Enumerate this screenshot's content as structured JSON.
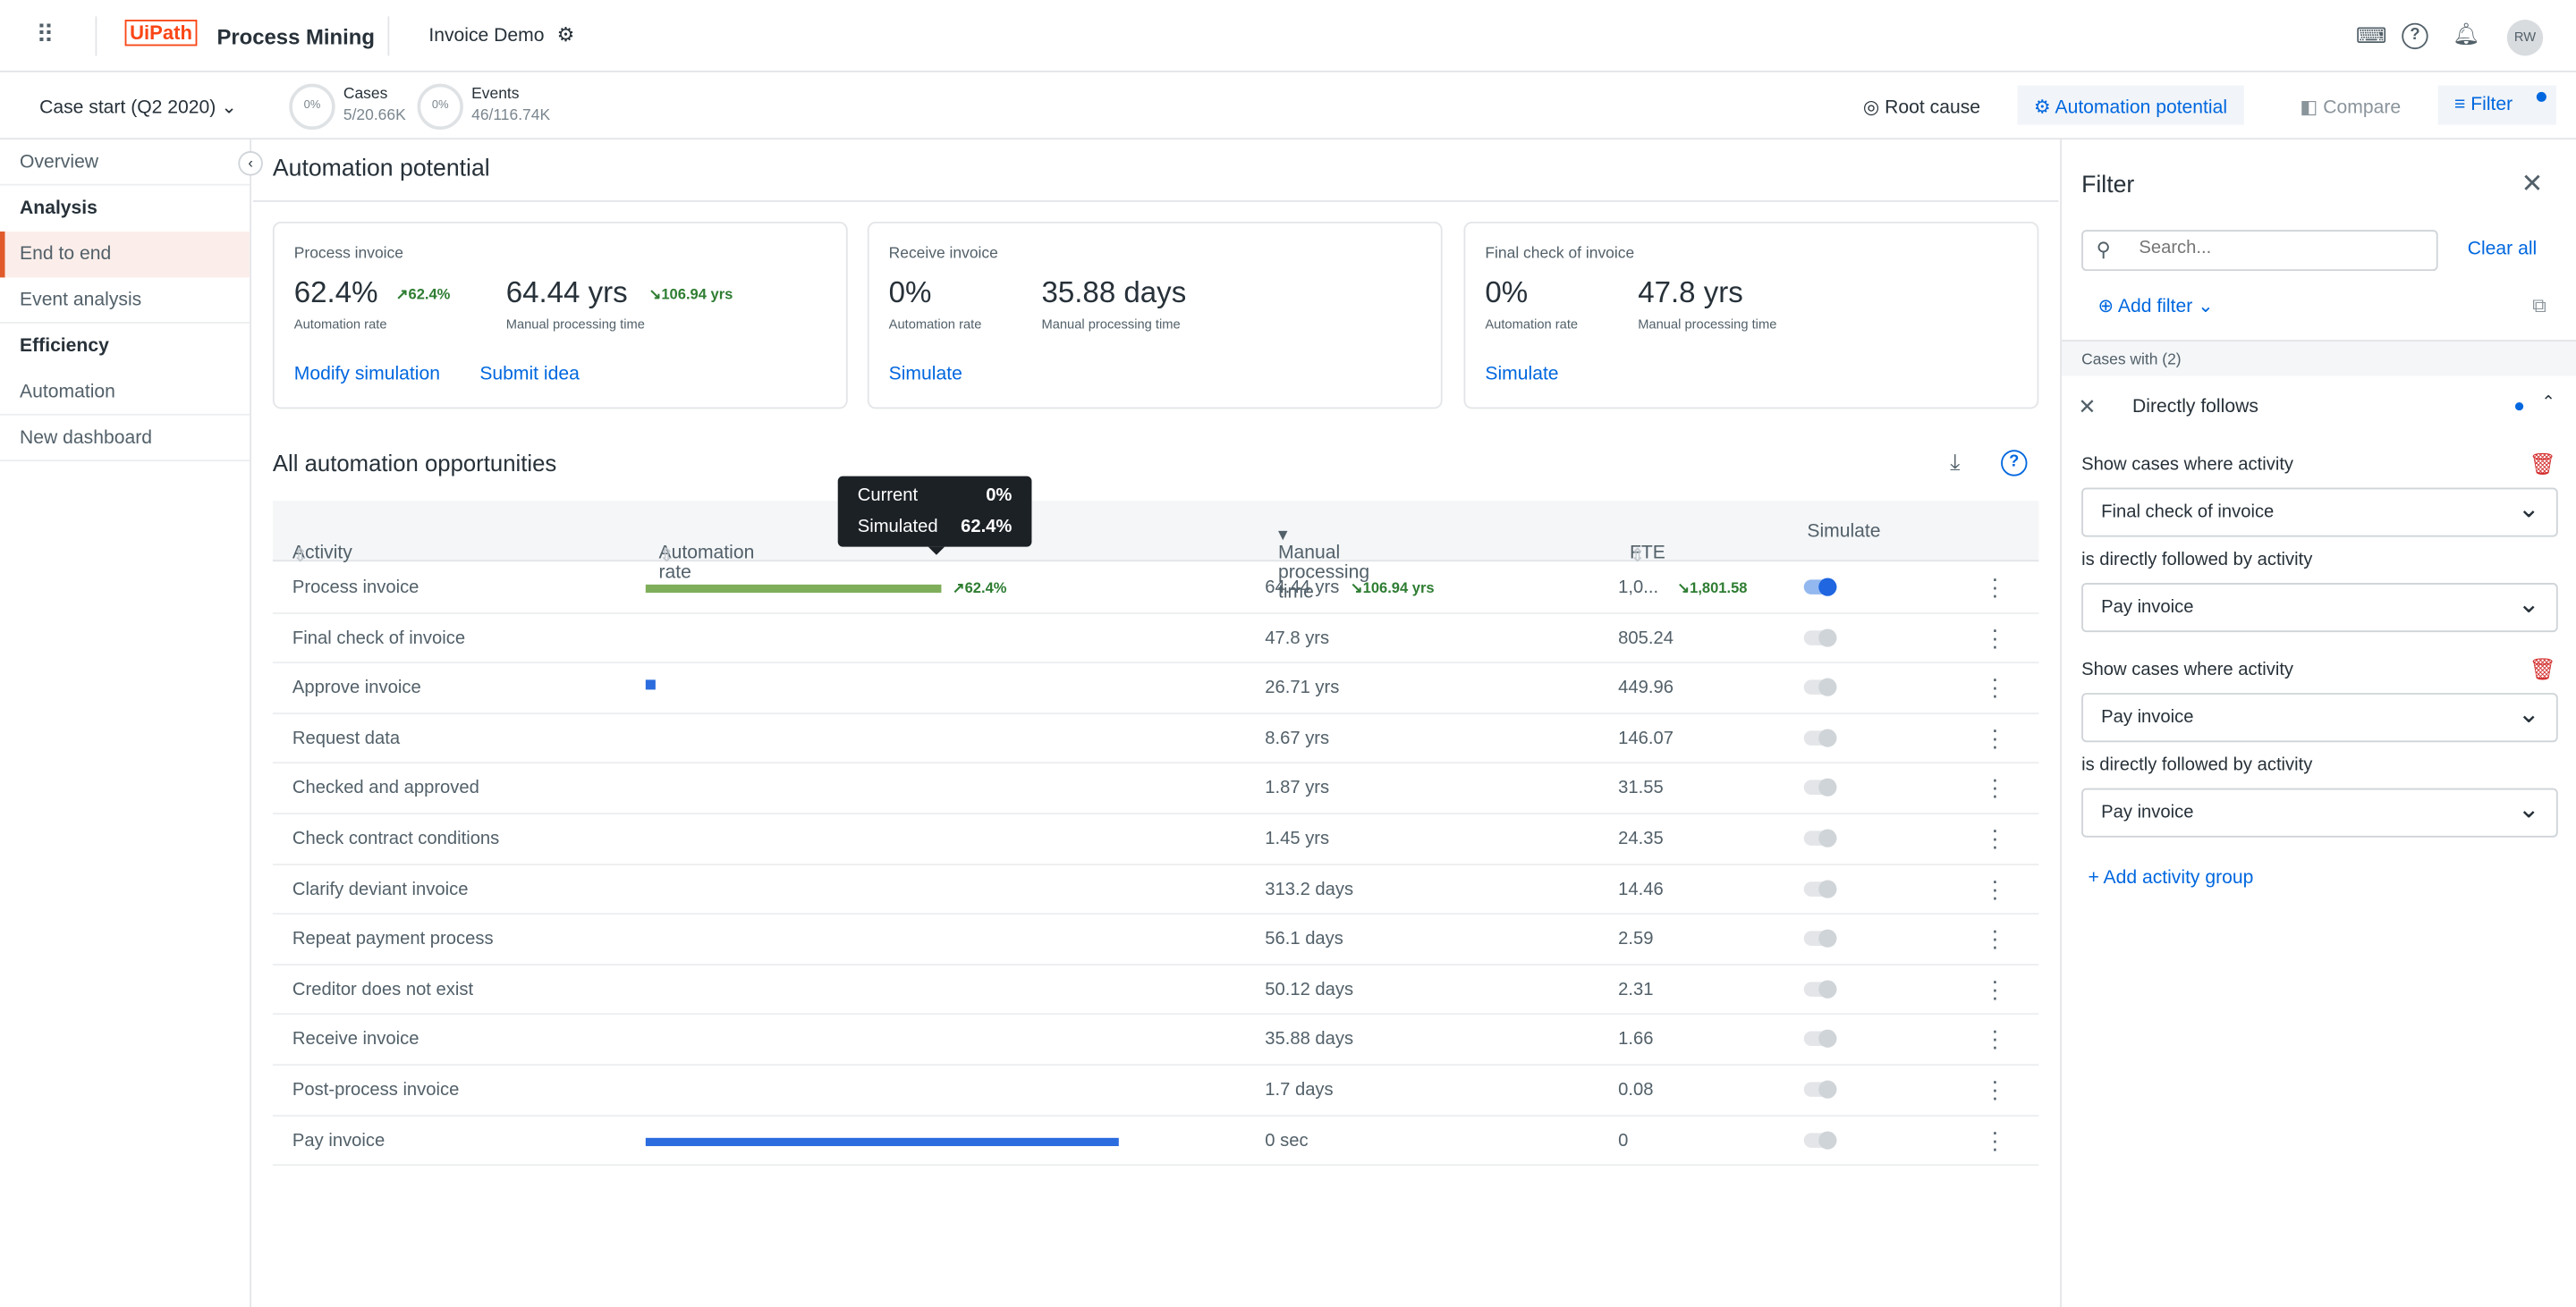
{
  "header": {
    "brand_logo": "UiPath",
    "brand": "Process Mining",
    "app": "Invoice Demo",
    "avatar": "RW",
    "icons": [
      "apps-grid-icon",
      "gear-icon",
      "keyboard-icon",
      "help-icon",
      "bell-icon"
    ]
  },
  "subbar": {
    "date_filter": "Case start (Q2 2020)",
    "cases": {
      "pct": "0%",
      "label": "Cases",
      "value": "5/20.66K"
    },
    "events": {
      "pct": "0%",
      "label": "Events",
      "value": "46/116.74K"
    },
    "buttons": [
      {
        "label": "Root cause"
      },
      {
        "label": "Automation potential"
      },
      {
        "label": "Compare"
      },
      {
        "label": "Filter"
      }
    ]
  },
  "sidebar": {
    "items": [
      {
        "label": "Overview"
      },
      {
        "label": "Analysis"
      },
      {
        "label": "End to end"
      },
      {
        "label": "Event analysis"
      },
      {
        "label": "Efficiency"
      },
      {
        "label": "Automation"
      },
      {
        "label": "New dashboard"
      }
    ]
  },
  "main": {
    "title": "Automation potential",
    "cards": [
      {
        "title": "Process invoice",
        "rate": "62.4%",
        "rate_delta": "62.4%",
        "rate_label": "Automation rate",
        "time": "64.44 yrs",
        "time_delta": "106.94 yrs",
        "time_label": "Manual processing time",
        "links": [
          "Modify simulation",
          "Submit idea"
        ]
      },
      {
        "title": "Receive invoice",
        "rate": "0%",
        "rate_label": "Automation rate",
        "time": "35.88 days",
        "time_label": "Manual processing time",
        "links": [
          "Simulate"
        ]
      },
      {
        "title": "Final check of invoice",
        "rate": "0%",
        "rate_label": "Automation rate",
        "time": "47.8 yrs",
        "time_label": "Manual processing time",
        "links": [
          "Simulate"
        ]
      }
    ],
    "table_title": "All automation opportunities",
    "columns": [
      "Activity",
      "Automation rate",
      "Manual processing time",
      "FTE",
      "Simulate"
    ],
    "tooltip": {
      "current_label": "Current",
      "current": "0%",
      "simulated_label": "Simulated",
      "simulated": "62.4%"
    },
    "rows": [
      {
        "activity": "Process invoice",
        "rate": 62.4,
        "rate_label": "62.4%",
        "rate_color": "#7fae5a",
        "time": "64.44 yrs",
        "time_delta": "106.94 yrs",
        "fte": "1,0...",
        "fte_delta": "1,801.58",
        "simulate": true
      },
      {
        "activity": "Final check of invoice",
        "rate": 0,
        "time": "47.8 yrs",
        "fte": "805.24",
        "simulate": false
      },
      {
        "activity": "Approve invoice",
        "rate": 2,
        "rate_color": "#2b6cde",
        "time": "26.71 yrs",
        "fte": "449.96",
        "simulate": false
      },
      {
        "activity": "Request data",
        "rate": 0,
        "time": "8.67 yrs",
        "fte": "146.07",
        "simulate": false
      },
      {
        "activity": "Checked and approved",
        "rate": 0,
        "time": "1.87 yrs",
        "fte": "31.55",
        "simulate": false
      },
      {
        "activity": "Check contract conditions",
        "rate": 0,
        "time": "1.45 yrs",
        "fte": "24.35",
        "simulate": false
      },
      {
        "activity": "Clarify deviant invoice",
        "rate": 0,
        "time": "313.2 days",
        "fte": "14.46",
        "simulate": false
      },
      {
        "activity": "Repeat payment process",
        "rate": 0,
        "time": "56.1 days",
        "fte": "2.59",
        "simulate": false
      },
      {
        "activity": "Creditor does not exist",
        "rate": 0,
        "time": "50.12 days",
        "fte": "2.31",
        "simulate": false
      },
      {
        "activity": "Receive invoice",
        "rate": 0,
        "time": "35.88 days",
        "fte": "1.66",
        "simulate": false
      },
      {
        "activity": "Post-process invoice",
        "rate": 0,
        "time": "1.7 days",
        "fte": "0.08",
        "simulate": false
      },
      {
        "activity": "Pay invoice",
        "rate": 100,
        "rate_color": "#2b6cde",
        "time": "0 sec",
        "fte": "0",
        "simulate": false
      }
    ]
  },
  "filter": {
    "title": "Filter",
    "search_placeholder": "Search...",
    "clear_all": "Clear all",
    "add_filter": "Add filter",
    "cases_with": "Cases with (2)",
    "group": "Directly follows",
    "conditions": [
      {
        "label": "Show cases where activity",
        "value": "Final check of invoice"
      },
      {
        "label": "is directly followed by activity",
        "value": "Pay invoice"
      },
      {
        "label": "Show cases where activity",
        "value": "Pay invoice"
      },
      {
        "label": "is directly followed by activity",
        "value": "Pay invoice"
      }
    ],
    "add_group": "Add activity group"
  },
  "colors": {
    "accent": "#0067df",
    "brand": "#fa4616",
    "active_nav": "#e05a2b",
    "positive": "#2e7d32"
  }
}
